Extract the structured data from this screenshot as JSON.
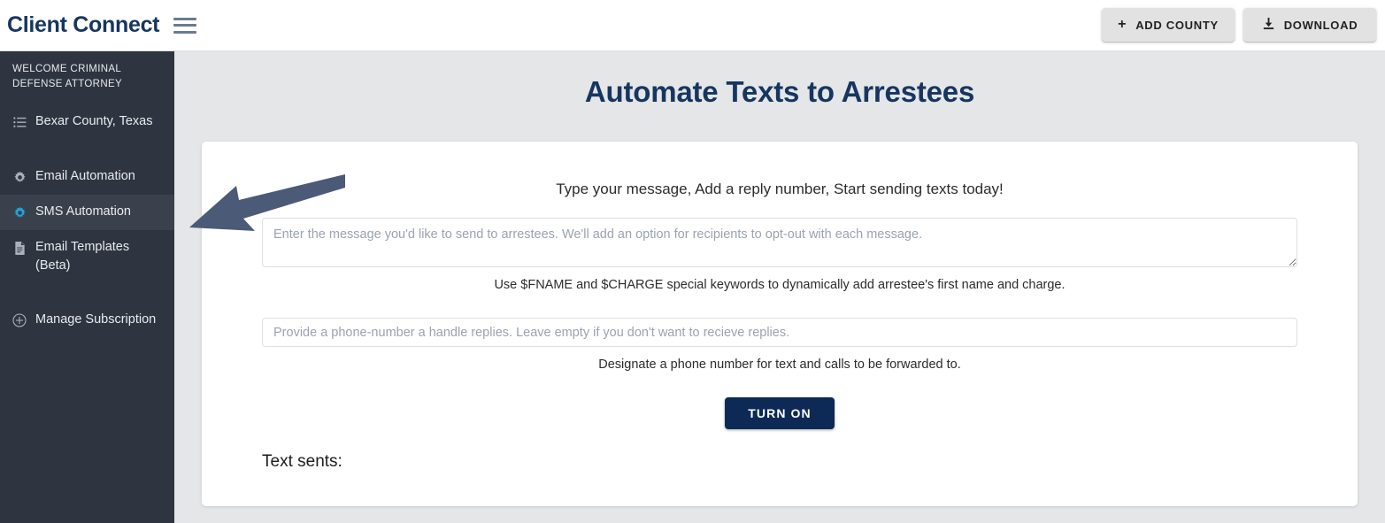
{
  "topbar": {
    "brand": "Client Connect",
    "menu_icon": "hamburger-icon",
    "buttons": [
      {
        "label": "ADD COUNTY",
        "icon": "plus-icon",
        "glyph": "+"
      },
      {
        "label": "DOWNLOAD",
        "icon": "download-icon",
        "glyph": "⬇"
      }
    ]
  },
  "sidebar": {
    "welcome": "WELCOME CRIMINAL DEFENSE ATTORNEY",
    "items": [
      {
        "label": "Bexar County, Texas",
        "icon": "list-icon",
        "active": false
      },
      {
        "label": "Email Automation",
        "icon": "gear-icon",
        "active": false
      },
      {
        "label": "SMS Automation",
        "icon": "gear-icon",
        "active": true
      },
      {
        "label": "Email Templates (Beta)",
        "icon": "document-icon",
        "active": false
      },
      {
        "label": "Manage Subscription",
        "icon": "plus-circle-icon",
        "active": false
      }
    ],
    "background_color": "#2e3440",
    "active_background_color": "#3b414c",
    "active_icon_color": "#1fa2dd"
  },
  "main": {
    "title": "Automate Texts to Arrestees",
    "title_color": "#16365f",
    "lead": "Type your message, Add a reply number, Start sending texts today!",
    "message_placeholder": "Enter the message you'd like to send to arrestees. We'll add an option for recipients to opt-out with each message.",
    "message_value": "",
    "message_hint": "Use $FNAME and $CHARGE special keywords to dynamically add arrestee's first name and charge.",
    "phone_placeholder": "Provide a phone-number a handle replies. Leave empty if you don't want to recieve replies.",
    "phone_value": "",
    "phone_hint": "Designate a phone number for text and calls to be forwarded to.",
    "turn_on_label": "TURN ON",
    "turn_on_color": "#0c2a55",
    "counter_label": "Text sents:",
    "counter_value": ""
  },
  "annotation": {
    "arrow_color": "#4a5a77",
    "arrow_points_to": "sidebar-item-sms-automation"
  }
}
